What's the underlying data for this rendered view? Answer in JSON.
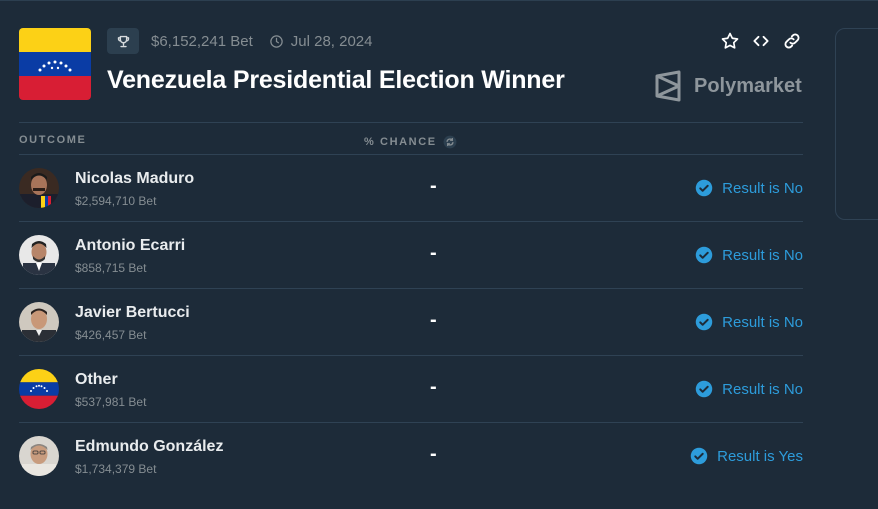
{
  "market": {
    "volume": "$6,152,241 Bet",
    "end_date": "Jul 28, 2024",
    "title": "Venezuela Presidential Election Winner",
    "brand": "Polymarket"
  },
  "table": {
    "outcome_header": "OUTCOME",
    "chance_header": "% CHANCE"
  },
  "rows": [
    {
      "name": "Nicolas Maduro",
      "bet": "$2,594,710 Bet",
      "chance": "-",
      "result": "Result is No"
    },
    {
      "name": "Antonio Ecarri",
      "bet": "$858,715 Bet",
      "chance": "-",
      "result": "Result is No"
    },
    {
      "name": "Javier Bertucci",
      "bet": "$426,457 Bet",
      "chance": "-",
      "result": "Result is No"
    },
    {
      "name": "Other",
      "bet": "$537,981 Bet",
      "chance": "-",
      "result": "Result is No"
    },
    {
      "name": "Edmundo González",
      "bet": "$1,734,379 Bet",
      "chance": "-",
      "result": "Result is Yes"
    }
  ],
  "icons": [
    "trophy-icon",
    "clock-icon",
    "star-icon",
    "embed-code-icon",
    "link-icon",
    "polymarket-logo-icon",
    "refresh-icon",
    "check-circle-icon"
  ],
  "colors": {
    "background": "#1d2b39",
    "divider": "#2f4254",
    "muted_text": "#858d92",
    "result_blue": "#2d9cdb",
    "flag_yellow": "#fcd116",
    "flag_blue": "#0a3ca5",
    "flag_red": "#d81e34"
  }
}
